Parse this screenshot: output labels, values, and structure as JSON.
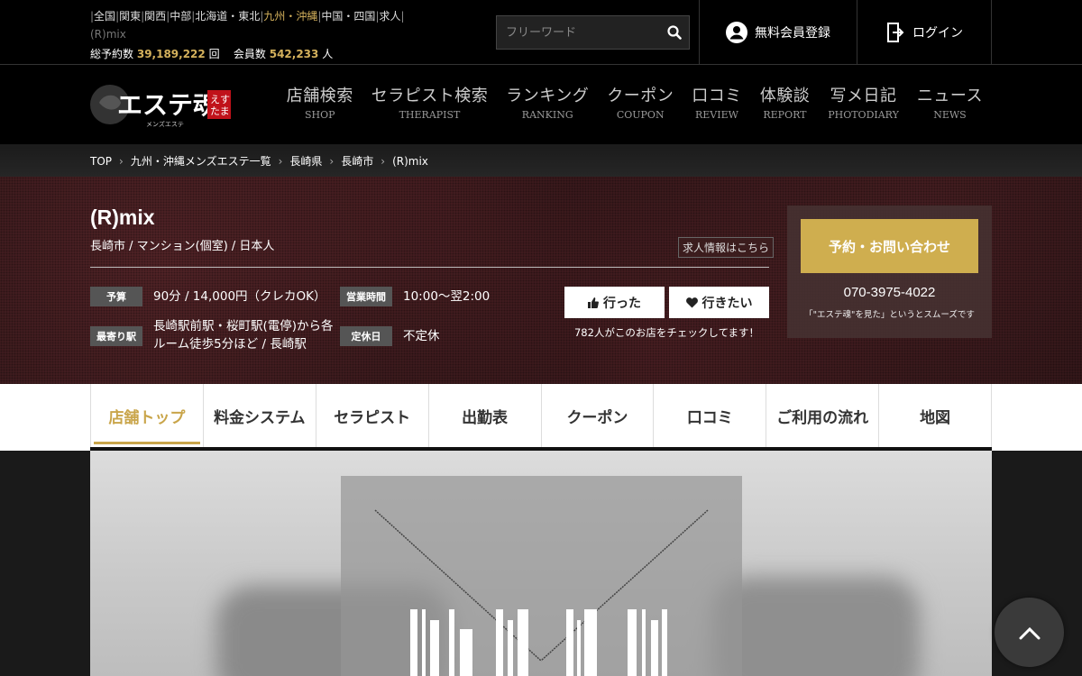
{
  "top": {
    "regions": [
      "全国",
      "関東",
      "関西",
      "中部",
      "北海道・東北",
      "九州・沖縄",
      "中国・四国",
      "求人"
    ],
    "active_region": "九州・沖縄",
    "current_shop": "(R)mix",
    "total_bookings_label": "総予約数",
    "total_bookings": "39,189,222",
    "total_bookings_unit": "回",
    "members_label": "会員数",
    "members": "542,233",
    "members_unit": "人",
    "search_placeholder": "フリーワード",
    "member_register": "無料会員登録",
    "login": "ログイン"
  },
  "logo": {
    "main": "エステ魂",
    "sub": "えすたま",
    "tagline": "メンズエステ"
  },
  "nav": [
    {
      "jp": "店舗検索",
      "en": "SHOP"
    },
    {
      "jp": "セラピスト検索",
      "en": "THERAPIST"
    },
    {
      "jp": "ランキング",
      "en": "RANKING"
    },
    {
      "jp": "クーポン",
      "en": "COUPON"
    },
    {
      "jp": "口コミ",
      "en": "REVIEW"
    },
    {
      "jp": "体験談",
      "en": "REPORT"
    },
    {
      "jp": "写メ日記",
      "en": "PHOTODIARY"
    },
    {
      "jp": "ニュース",
      "en": "NEWS"
    }
  ],
  "breadcrumb": [
    "TOP",
    "九州・沖縄メンズエステ一覧",
    "長崎県",
    "長崎市",
    "(R)mix"
  ],
  "shop": {
    "name": "(R)mix",
    "subtitle": "長崎市 / マンション(個室) / 日本人",
    "recruit_link": "求人情報はこちら",
    "budget_label": "予算",
    "budget": "90分 / 14,000円（クレカOK）",
    "hours_label": "営業時間",
    "hours": "10:00～翌2:00",
    "station_label": "最寄り駅",
    "station_line1": "長崎駅前駅・桜町駅(電停)から各",
    "station_line2": "ルーム徒歩5分ほど / 長崎駅",
    "holiday_label": "定休日",
    "holiday": "不定休",
    "went_button": "行った",
    "want_button": "行きたい",
    "check_text": "782人がこのお店をチェックしてます！",
    "contact_button": "予約・お問い合わせ",
    "phone": "070-3975-4022",
    "phone_note": "「\"エステ魂\"を見た」というとスムーズです"
  },
  "tabs": [
    "店舗トップ",
    "料金システム",
    "セラピスト",
    "出勤表",
    "クーポン",
    "口コミ",
    "ご利用の流れ",
    "地図"
  ],
  "colors": {
    "accent_gold": "#cfae4f",
    "active_tab": "#c9a54a",
    "header_bg": "#000000",
    "hero_bg": "#2a1416"
  },
  "icons": [
    "search-icon",
    "user-icon",
    "login-door-icon",
    "thumbs-up-icon",
    "heart-icon",
    "chevron-up-icon"
  ]
}
